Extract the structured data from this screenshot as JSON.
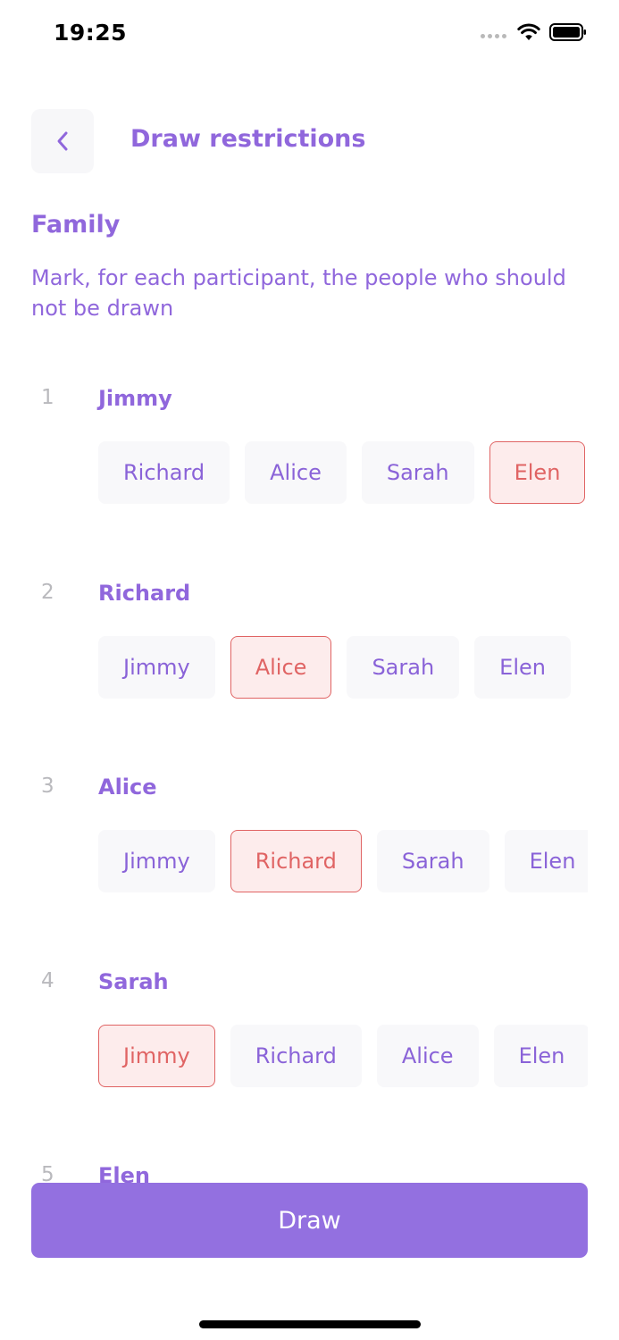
{
  "status_bar": {
    "time": "19:25",
    "icons": [
      "signal-dots-icon",
      "wifi-icon",
      "battery-icon"
    ]
  },
  "header": {
    "back_icon": "chevron-left-icon",
    "title": "Draw restrictions"
  },
  "group": {
    "name": "Family",
    "instructions": "Mark, for each participant, the people who should not be drawn"
  },
  "participants": [
    {
      "index": "1",
      "name": "Jimmy",
      "options": [
        {
          "label": "Richard",
          "selected": false
        },
        {
          "label": "Alice",
          "selected": false
        },
        {
          "label": "Sarah",
          "selected": false
        },
        {
          "label": "Elen",
          "selected": true
        }
      ]
    },
    {
      "index": "2",
      "name": "Richard",
      "options": [
        {
          "label": "Jimmy",
          "selected": false
        },
        {
          "label": "Alice",
          "selected": true
        },
        {
          "label": "Sarah",
          "selected": false
        },
        {
          "label": "Elen",
          "selected": false
        }
      ]
    },
    {
      "index": "3",
      "name": "Alice",
      "options": [
        {
          "label": "Jimmy",
          "selected": false
        },
        {
          "label": "Richard",
          "selected": true
        },
        {
          "label": "Sarah",
          "selected": false
        },
        {
          "label": "Elen",
          "selected": false
        }
      ]
    },
    {
      "index": "4",
      "name": "Sarah",
      "options": [
        {
          "label": "Jimmy",
          "selected": true
        },
        {
          "label": "Richard",
          "selected": false
        },
        {
          "label": "Alice",
          "selected": false
        },
        {
          "label": "Elen",
          "selected": false
        }
      ]
    },
    {
      "index": "5",
      "name": "Elen",
      "options": []
    }
  ],
  "footer": {
    "draw_label": "Draw"
  },
  "colors": {
    "accent": "#9067dc",
    "button": "#9370e0",
    "selected_text": "#e06464",
    "selected_bg": "#fdecec",
    "chip_bg": "#f8f8fa",
    "index_text": "#b9b9bd"
  }
}
